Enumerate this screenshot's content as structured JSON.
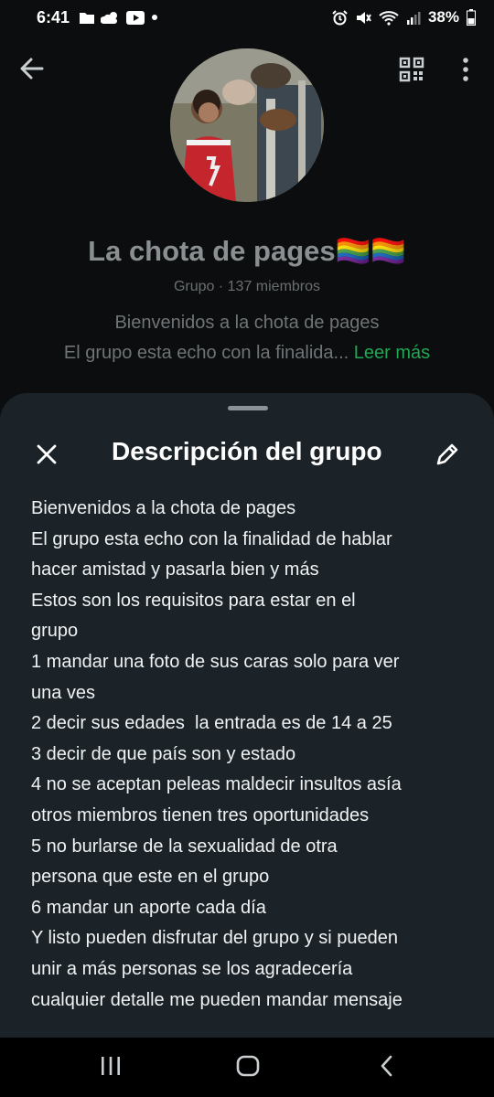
{
  "status_bar": {
    "time": "6:41",
    "left_icons": [
      "folder-icon",
      "cloud-weather-icon",
      "youtube-icon",
      "dot-icon"
    ],
    "right_icons": [
      "alarm-icon",
      "mute-icon",
      "wifi-icon",
      "signal-icon"
    ],
    "battery_text": "38%"
  },
  "header": {
    "group_title": "La chota de pages🏳️‍🌈🏳️‍🌈",
    "group_meta": "Grupo · 137 miembros",
    "description_preview_line1": "Bienvenidos a la chota de pages",
    "description_preview_line2": "El grupo esta echo con la finalida...",
    "read_more_label": "Leer más"
  },
  "sheet": {
    "title": "Descripción del grupo",
    "description_lines": [
      "Bienvenidos a la chota de pages",
      "El grupo esta echo con la finalidad de hablar",
      "hacer amistad y pasarla bien y más",
      "Estos son los requisitos para estar en el",
      "grupo",
      "1 mandar una foto de sus caras solo para ver",
      "una ves",
      "2 decir sus edades  la entrada es de 14 a 25",
      "3 decir de que país son y estado",
      "4 no se aceptan peleas maldecir insultos asía",
      "otros miembros tienen tres oportunidades",
      "5 no burlarse de la sexualidad de otra",
      "persona que este en el grupo",
      "6 mandar un aporte cada día",
      "Y listo pueden disfrutar del grupo y si pueden",
      "unir a más personas se los agradecería",
      "cualquier detalle me pueden mandar mensaje"
    ]
  },
  "colors": {
    "background": "#0b0d0e",
    "sheet": "#1b2328",
    "accent_green": "#21a855",
    "dim_text": "#6f7477"
  }
}
